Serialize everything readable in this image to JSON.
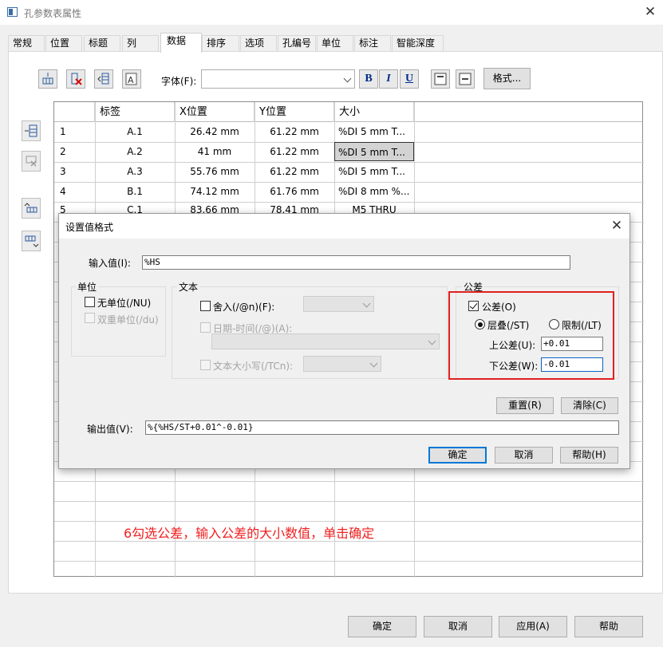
{
  "window": {
    "title": "孔参数表属性",
    "close": "✕"
  },
  "tabs": [
    "常规",
    "位置",
    "标题",
    "列",
    "数据",
    "排序",
    "选项",
    "孔编号",
    "单位",
    "标注",
    "智能深度"
  ],
  "toolbar": {
    "font_label": "字体(F):",
    "font_value": "",
    "bold": "B",
    "italic": "I",
    "underline": "U",
    "format_button": "格式..."
  },
  "table": {
    "headers": [
      "",
      "标签",
      "X位置",
      "Y位置",
      "大小"
    ],
    "rows": [
      [
        "1",
        "A.1",
        "26.42 mm",
        "61.22 mm",
        "%DI 5 mm T..."
      ],
      [
        "2",
        "A.2",
        "41 mm",
        "61.22 mm",
        "%DI 5 mm T..."
      ],
      [
        "3",
        "A.3",
        "55.76 mm",
        "61.22 mm",
        "%DI 5 mm T..."
      ],
      [
        "4",
        "B.1",
        "74.12 mm",
        "61.76 mm",
        "%DI 8 mm %..."
      ],
      [
        "5",
        "C.1",
        "83.66 mm",
        "78.41 mm",
        "M5 THRU"
      ]
    ]
  },
  "annotation": "6勾选公差，输入公差的大小数值，单击确定",
  "bottom_buttons": {
    "ok": "确定",
    "cancel": "取消",
    "apply": "应用(A)",
    "help": "帮助"
  },
  "dialog": {
    "title": "设置值格式",
    "close": "✕",
    "input_label": "输入值(I):",
    "input_value": "%HS",
    "unit_group": "单位",
    "no_unit": "无单位(/NU)",
    "dual_unit": "双重单位(/du)",
    "text_group": "文本",
    "round": "舍入(/@n)(F):",
    "datetime": "日期-时间(/@)(A):",
    "text_case": "文本大小写(/TCn):",
    "tolerance_group": "公差",
    "tolerance_check": "公差(O)",
    "stacked": "层叠(/ST)",
    "limit": "限制(/LT)",
    "upper_label": "上公差(U):",
    "upper_value": "+0.01",
    "lower_label": "下公差(W):",
    "lower_value": "-0.01",
    "reset": "重置(R)",
    "clear": "清除(C)",
    "output_label": "输出值(V):",
    "output_value": "%{%HS/ST+0.01^-0.01}",
    "ok": "确定",
    "cancel": "取消",
    "help": "帮助(H)"
  },
  "colors": {
    "accent": "#0078d7",
    "annotation": "#f02020",
    "tolerance_frame": "#e02020"
  }
}
